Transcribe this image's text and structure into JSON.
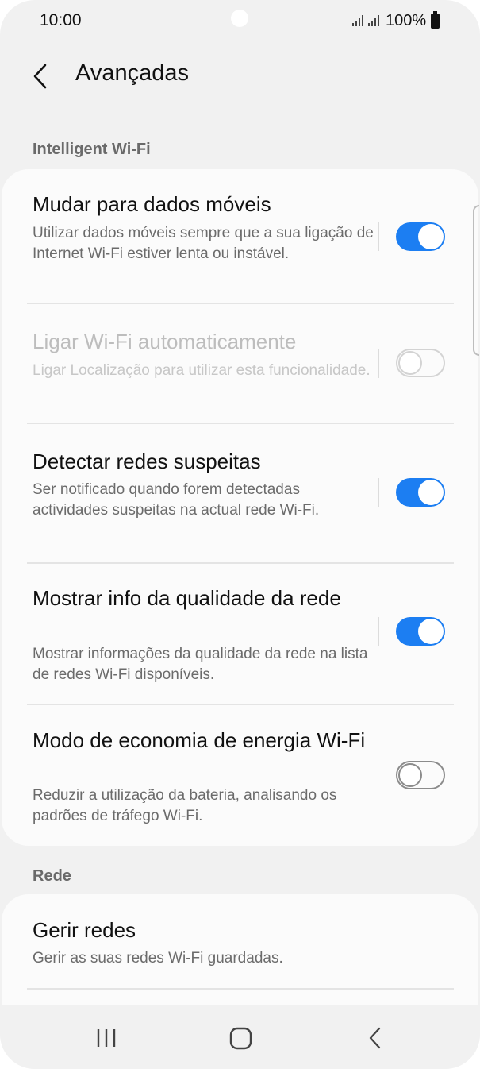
{
  "status": {
    "time": "10:00",
    "battery": "100%"
  },
  "header": {
    "title": "Avançadas"
  },
  "sections": {
    "intelligent": "Intelligent Wi-Fi",
    "network": "Rede"
  },
  "settings": [
    {
      "title": "Mudar para dados móveis",
      "subtitle": "Utilizar dados móveis sempre que a sua ligação de Internet Wi-Fi estiver lenta ou instável.",
      "enabled": true,
      "on": true
    },
    {
      "title": "Ligar Wi-Fi automaticamente",
      "subtitle": "Ligar Localização para utilizar esta funcionalidade.",
      "enabled": false,
      "on": false
    },
    {
      "title": "Detectar redes suspeitas",
      "subtitle": "Ser notificado quando forem detectadas actividades suspeitas na actual rede Wi-Fi.",
      "enabled": true,
      "on": true
    },
    {
      "title": "Mostrar info da qualidade da rede",
      "subtitle": "Mostrar informações da qualidade da rede na lista de redes Wi-Fi disponíveis.",
      "enabled": true,
      "on": true
    },
    {
      "title": "Modo de economia de energia Wi-Fi",
      "subtitle": "Reduzir a utilização da bateria, analisando os padrões de tráfego Wi-Fi.",
      "enabled": true,
      "on": false
    }
  ],
  "network_items": [
    {
      "title": "Gerir redes",
      "subtitle": "Gerir as suas redes Wi-Fi guardadas."
    }
  ],
  "colors": {
    "accent": "#1c7ef2",
    "background": "#f1f1f1",
    "card": "#fbfbfb"
  }
}
